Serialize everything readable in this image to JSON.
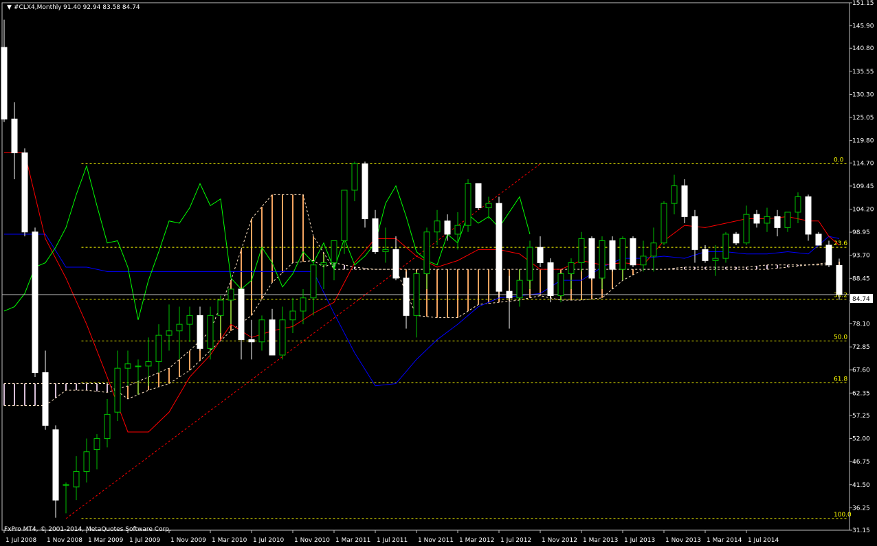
{
  "header": {
    "symbol": "#CLX4,Monthly",
    "ohlc": "91.40 92.94 83.58 84.74"
  },
  "footer": {
    "copyright": "FxPro MT4, © 2001-2014, MetaQuotes Software Corp."
  },
  "price_tag": "84.74",
  "colors": {
    "background": "#000000",
    "bull_candle": "#00c000",
    "bear_candle": "#ffffff",
    "tenkan": "#ff0000",
    "kijun": "#0000ff",
    "chikou": "#00ff00",
    "kumo_bull": "#f4a460",
    "kumo_bear": "#d8bfd8",
    "fib": "#ffff00",
    "trendline": "#ff0000"
  },
  "chart_data": {
    "type": "candlestick",
    "y_ticks": [
      "151.15",
      "145.90",
      "140.80",
      "135.55",
      "130.30",
      "125.05",
      "119.80",
      "114.70",
      "109.45",
      "104.20",
      "98.95",
      "93.70",
      "88.45",
      "83.35",
      "78.10",
      "72.85",
      "67.60",
      "62.35",
      "57.25",
      "52.00",
      "46.75",
      "41.50",
      "36.25",
      "31.15"
    ],
    "ylim": [
      31.15,
      151.15
    ],
    "x_ticks": [
      "1 Jul 2008",
      "1 Nov 2008",
      "1 Mar 2009",
      "1 Jul 2009",
      "1 Nov 2009",
      "1 Mar 2010",
      "1 Jul 2010",
      "1 Nov 2010",
      "1 Mar 2011",
      "1 Jul 2011",
      "1 Nov 2011",
      "1 Mar 2012",
      "1 Jul 2012",
      "1 Nov 2012",
      "1 Mar 2013",
      "1 Jul 2013",
      "1 Nov 2013",
      "1 Mar 2014",
      "1 Jul 2014"
    ],
    "current_price": 84.74,
    "candles": [
      [
        141.0,
        147.3,
        124.0,
        124.7
      ],
      [
        124.7,
        128.5,
        111.0,
        117.0
      ],
      [
        117.0,
        118.0,
        98.0,
        99.0
      ],
      [
        99.0,
        100.0,
        66.0,
        67.0
      ],
      [
        67.0,
        72.0,
        54.0,
        55.0
      ],
      [
        54.0,
        55.0,
        34.0,
        38.0
      ],
      [
        41.5,
        42.0,
        35.0,
        41.5
      ],
      [
        41.0,
        48.0,
        38.0,
        44.5
      ],
      [
        44.5,
        52.0,
        42.0,
        49.0
      ],
      [
        49.5,
        53.0,
        45.0,
        52.0
      ],
      [
        52.0,
        61.0,
        50.0,
        57.5
      ],
      [
        58.0,
        72.0,
        56.0,
        68.0
      ],
      [
        68.0,
        72.0,
        64.0,
        69.0
      ],
      [
        68.5,
        70.0,
        62.0,
        68.5
      ],
      [
        68.5,
        75.0,
        64.0,
        69.5
      ],
      [
        69.5,
        78.0,
        67.0,
        75.5
      ],
      [
        75.5,
        82.5,
        72.0,
        76.5
      ],
      [
        76.5,
        82.0,
        70.0,
        78.0
      ],
      [
        78.0,
        82.0,
        74.0,
        80.0
      ],
      [
        80.0,
        82.0,
        72.0,
        72.5
      ],
      [
        72.5,
        82.0,
        70.0,
        80.0
      ],
      [
        80.0,
        84.5,
        76.0,
        83.5
      ],
      [
        83.5,
        86.0,
        78.0,
        86.0
      ],
      [
        86.0,
        86.0,
        70.0,
        74.5
      ],
      [
        74.5,
        79.0,
        70.0,
        74.0
      ],
      [
        74.0,
        80.0,
        72.0,
        79.0
      ],
      [
        79.0,
        81.5,
        72.0,
        71.0
      ],
      [
        71.0,
        82.0,
        70.0,
        79.0
      ],
      [
        79.0,
        84.0,
        76.0,
        81.0
      ],
      [
        81.0,
        86.0,
        78.0,
        84.0
      ],
      [
        84.0,
        92.0,
        80.0,
        91.5
      ],
      [
        91.5,
        94.0,
        86.0,
        92.0
      ],
      [
        92.0,
        96.0,
        88.0,
        97.0
      ],
      [
        97.0,
        108.0,
        94.0,
        108.5
      ],
      [
        108.5,
        115.0,
        106.0,
        114.5
      ],
      [
        114.5,
        115.0,
        100.0,
        102.0
      ],
      [
        102.0,
        104.0,
        94.0,
        94.5
      ],
      [
        94.5,
        100.0,
        92.0,
        95.0
      ],
      [
        95.0,
        98.0,
        88.0,
        88.5
      ],
      [
        88.5,
        90.0,
        77.0,
        80.0
      ],
      [
        80.0,
        90.0,
        75.0,
        89.5
      ],
      [
        89.5,
        100.0,
        86.0,
        99.0
      ],
      [
        99.0,
        104.0,
        96.0,
        101.5
      ],
      [
        101.5,
        103.0,
        97.0,
        98.5
      ],
      [
        98.5,
        103.5,
        95.0,
        100.5
      ],
      [
        100.5,
        111.0,
        99.0,
        110.0
      ],
      [
        110.0,
        110.0,
        104.0,
        104.5
      ],
      [
        104.5,
        107.0,
        102.0,
        105.5
      ],
      [
        105.5,
        107.0,
        84.0,
        85.5
      ],
      [
        85.5,
        89.0,
        77.0,
        84.0
      ],
      [
        84.0,
        90.5,
        82.0,
        88.0
      ],
      [
        88.0,
        97.0,
        86.0,
        95.5
      ],
      [
        95.5,
        98.0,
        91.0,
        92.0
      ],
      [
        92.0,
        93.0,
        83.0,
        84.5
      ],
      [
        84.5,
        89.0,
        83.0,
        89.5
      ],
      [
        89.5,
        93.0,
        86.0,
        92.0
      ],
      [
        92.0,
        99.0,
        90.0,
        97.5
      ],
      [
        97.5,
        98.0,
        88.0,
        88.5
      ],
      [
        88.5,
        98.0,
        86.0,
        97.0
      ],
      [
        97.0,
        98.0,
        90.0,
        90.5
      ],
      [
        90.5,
        98.0,
        88.0,
        97.5
      ],
      [
        97.5,
        98.0,
        91.0,
        91.5
      ],
      [
        91.5,
        97.0,
        90.0,
        93.5
      ],
      [
        93.5,
        100.0,
        90.0,
        96.5
      ],
      [
        96.5,
        106.0,
        96.0,
        105.5
      ],
      [
        105.5,
        112.0,
        103.0,
        109.5
      ],
      [
        109.5,
        111.0,
        101.0,
        102.5
      ],
      [
        102.5,
        104.0,
        92.0,
        95.0
      ],
      [
        95.0,
        96.0,
        92.0,
        92.5
      ],
      [
        92.5,
        96.0,
        89.0,
        93.0
      ],
      [
        93.0,
        99.0,
        92.0,
        98.5
      ],
      [
        98.5,
        99.0,
        96.0,
        96.5
      ],
      [
        96.5,
        105.0,
        96.0,
        103.0
      ],
      [
        103.0,
        104.0,
        100.0,
        101.0
      ],
      [
        101.0,
        104.5,
        99.0,
        102.5
      ],
      [
        102.5,
        104.0,
        98.0,
        100.0
      ],
      [
        100.0,
        103.0,
        99.0,
        103.5
      ],
      [
        103.5,
        108.0,
        101.0,
        107.0
      ],
      [
        107.0,
        107.5,
        97.0,
        98.5
      ],
      [
        98.5,
        99.0,
        96.0,
        96.0
      ],
      [
        96.0,
        97.0,
        91.0,
        91.5
      ],
      [
        91.4,
        92.94,
        83.58,
        84.74
      ]
    ],
    "tenkan": [
      [
        0,
        117.0
      ],
      [
        2,
        117.0
      ],
      [
        4,
        97.5
      ],
      [
        6,
        88.5
      ],
      [
        8,
        78.0
      ],
      [
        10,
        66.0
      ],
      [
        12,
        53.5
      ],
      [
        14,
        53.5
      ],
      [
        16,
        58.0
      ],
      [
        18,
        66.0
      ],
      [
        20,
        71.0
      ],
      [
        22,
        78.0
      ],
      [
        24,
        75.0
      ],
      [
        26,
        76.5
      ],
      [
        28,
        77.5
      ],
      [
        30,
        80.5
      ],
      [
        32,
        83.0
      ],
      [
        34,
        92.0
      ],
      [
        36,
        97.5
      ],
      [
        38,
        97.5
      ],
      [
        40,
        93.5
      ],
      [
        42,
        91.0
      ],
      [
        44,
        92.5
      ],
      [
        46,
        95.0
      ],
      [
        48,
        95.0
      ],
      [
        50,
        94.0
      ],
      [
        52,
        90.5
      ],
      [
        54,
        90.5
      ],
      [
        56,
        92.5
      ],
      [
        58,
        91.5
      ],
      [
        60,
        92.0
      ],
      [
        62,
        91.5
      ],
      [
        64,
        97.0
      ],
      [
        66,
        100.5
      ],
      [
        68,
        100.0
      ],
      [
        70,
        101.0
      ],
      [
        72,
        102.0
      ],
      [
        74,
        102.0
      ],
      [
        76,
        102.5
      ],
      [
        78,
        101.5
      ],
      [
        79,
        101.5
      ],
      [
        80,
        98.0
      ],
      [
        81,
        96.0
      ]
    ],
    "kijun": [
      [
        0,
        98.5
      ],
      [
        4,
        98.5
      ],
      [
        6,
        91.0
      ],
      [
        8,
        91.0
      ],
      [
        10,
        90.0
      ],
      [
        30,
        90.0
      ],
      [
        32,
        80.5
      ],
      [
        34,
        71.5
      ],
      [
        36,
        64.0
      ],
      [
        38,
        64.5
      ],
      [
        40,
        70.0
      ],
      [
        42,
        74.5
      ],
      [
        44,
        78.0
      ],
      [
        46,
        82.0
      ],
      [
        48,
        84.0
      ],
      [
        50,
        84.5
      ],
      [
        52,
        85.0
      ],
      [
        54,
        88.0
      ],
      [
        56,
        88.0
      ],
      [
        58,
        91.0
      ],
      [
        60,
        93.0
      ],
      [
        62,
        93.0
      ],
      [
        64,
        93.5
      ],
      [
        66,
        93.0
      ],
      [
        68,
        94.5
      ],
      [
        70,
        94.5
      ],
      [
        72,
        94.0
      ],
      [
        74,
        94.0
      ],
      [
        76,
        94.5
      ],
      [
        78,
        94.0
      ],
      [
        80,
        98.0
      ],
      [
        81,
        97.5
      ]
    ],
    "chikou": [
      [
        0,
        81.0
      ],
      [
        1,
        82.0
      ],
      [
        2,
        85.0
      ],
      [
        3,
        91.0
      ],
      [
        4,
        92.0
      ],
      [
        5,
        95.5
      ],
      [
        6,
        100.0
      ],
      [
        7,
        107.5
      ],
      [
        8,
        114.0
      ],
      [
        9,
        105.0
      ],
      [
        10,
        96.5
      ],
      [
        11,
        97.0
      ],
      [
        12,
        91.0
      ],
      [
        13,
        79.0
      ],
      [
        14,
        88.0
      ],
      [
        15,
        94.5
      ],
      [
        16,
        101.5
      ],
      [
        17,
        101.0
      ],
      [
        18,
        104.5
      ],
      [
        19,
        110.0
      ],
      [
        20,
        105.0
      ],
      [
        21,
        106.5
      ],
      [
        22,
        88.5
      ],
      [
        23,
        86.0
      ],
      [
        24,
        88.0
      ],
      [
        25,
        95.5
      ],
      [
        26,
        92.0
      ],
      [
        27,
        86.5
      ],
      [
        28,
        89.5
      ],
      [
        29,
        94.5
      ],
      [
        30,
        92.0
      ],
      [
        31,
        96.5
      ],
      [
        32,
        90.5
      ],
      [
        33,
        97.5
      ],
      [
        34,
        91.5
      ],
      [
        35,
        93.5
      ],
      [
        36,
        96.5
      ],
      [
        37,
        105.5
      ],
      [
        38,
        109.5
      ],
      [
        39,
        102.5
      ],
      [
        40,
        94.5
      ],
      [
        41,
        92.5
      ],
      [
        42,
        91.5
      ],
      [
        43,
        98.5
      ],
      [
        44,
        96.5
      ],
      [
        45,
        103.0
      ],
      [
        46,
        101.0
      ],
      [
        47,
        102.5
      ],
      [
        48,
        100.0
      ],
      [
        49,
        103.5
      ],
      [
        50,
        107.0
      ],
      [
        51,
        98.5
      ]
    ],
    "senkou_a": [
      [
        0,
        64.5
      ],
      [
        4,
        64.5
      ],
      [
        6,
        64.5
      ],
      [
        8,
        64.5
      ],
      [
        10,
        64.5
      ],
      [
        12,
        61.0
      ],
      [
        14,
        63.0
      ],
      [
        16,
        64.5
      ],
      [
        18,
        67.5
      ],
      [
        20,
        72.0
      ],
      [
        22,
        76.5
      ],
      [
        24,
        80.0
      ],
      [
        26,
        87.5
      ],
      [
        28,
        92.0
      ],
      [
        30,
        92.5
      ],
      [
        31,
        91.0
      ],
      [
        32,
        92.0
      ],
      [
        34,
        91.0
      ],
      [
        36,
        90.5
      ],
      [
        38,
        90.5
      ],
      [
        40,
        80.0
      ],
      [
        42,
        79.5
      ],
      [
        44,
        79.5
      ],
      [
        46,
        82.5
      ],
      [
        48,
        83.0
      ],
      [
        50,
        83.5
      ],
      [
        52,
        84.5
      ],
      [
        54,
        83.5
      ],
      [
        56,
        83.5
      ],
      [
        58,
        84.0
      ],
      [
        60,
        88.0
      ],
      [
        62,
        90.5
      ],
      [
        64,
        90.5
      ],
      [
        66,
        91.0
      ],
      [
        68,
        91.0
      ],
      [
        70,
        91.0
      ],
      [
        72,
        91.0
      ],
      [
        74,
        91.5
      ],
      [
        76,
        91.5
      ],
      [
        78,
        91.5
      ],
      [
        80,
        91.5
      ],
      [
        82,
        91.5
      ],
      [
        84,
        91.5
      ],
      [
        86,
        91.5
      ],
      [
        88,
        91.5
      ]
    ],
    "senkou_b": [
      [
        0,
        59.5
      ],
      [
        4,
        59.5
      ],
      [
        6,
        63.0
      ],
      [
        8,
        63.0
      ],
      [
        10,
        62.5
      ],
      [
        12,
        64.0
      ],
      [
        14,
        66.0
      ],
      [
        16,
        68.0
      ],
      [
        18,
        72.0
      ],
      [
        20,
        76.5
      ],
      [
        22,
        88.0
      ],
      [
        24,
        102.0
      ],
      [
        26,
        107.5
      ],
      [
        28,
        107.5
      ],
      [
        29,
        107.5
      ],
      [
        30,
        98.0
      ],
      [
        32,
        90.5
      ],
      [
        34,
        90.5
      ],
      [
        36,
        90.5
      ],
      [
        38,
        90.5
      ],
      [
        40,
        90.5
      ],
      [
        42,
        90.5
      ],
      [
        44,
        90.5
      ],
      [
        46,
        90.5
      ],
      [
        48,
        90.5
      ],
      [
        50,
        90.5
      ],
      [
        52,
        90.5
      ],
      [
        54,
        90.5
      ],
      [
        56,
        90.5
      ],
      [
        58,
        90.5
      ],
      [
        60,
        90.5
      ],
      [
        62,
        90.5
      ],
      [
        64,
        90.5
      ],
      [
        66,
        90.5
      ],
      [
        68,
        90.5
      ],
      [
        70,
        90.5
      ],
      [
        72,
        90.5
      ],
      [
        74,
        90.5
      ],
      [
        76,
        91.0
      ],
      [
        78,
        91.5
      ],
      [
        80,
        92.0
      ],
      [
        82,
        92.5
      ],
      [
        84,
        93.0
      ],
      [
        86,
        93.5
      ],
      [
        88,
        93.5
      ]
    ],
    "fibonacci": {
      "levels": [
        {
          "label": "0.0",
          "price": 114.5
        },
        {
          "label": "23.6",
          "price": 95.5
        },
        {
          "label": "38.2",
          "price": 83.7
        },
        {
          "label": "50.0",
          "price": 74.2
        },
        {
          "label": "61.8",
          "price": 64.7
        },
        {
          "label": "100.0",
          "price": 33.8
        }
      ]
    },
    "trendline": {
      "from": [
        6,
        33.8
      ],
      "to": [
        52,
        114.5
      ]
    }
  }
}
